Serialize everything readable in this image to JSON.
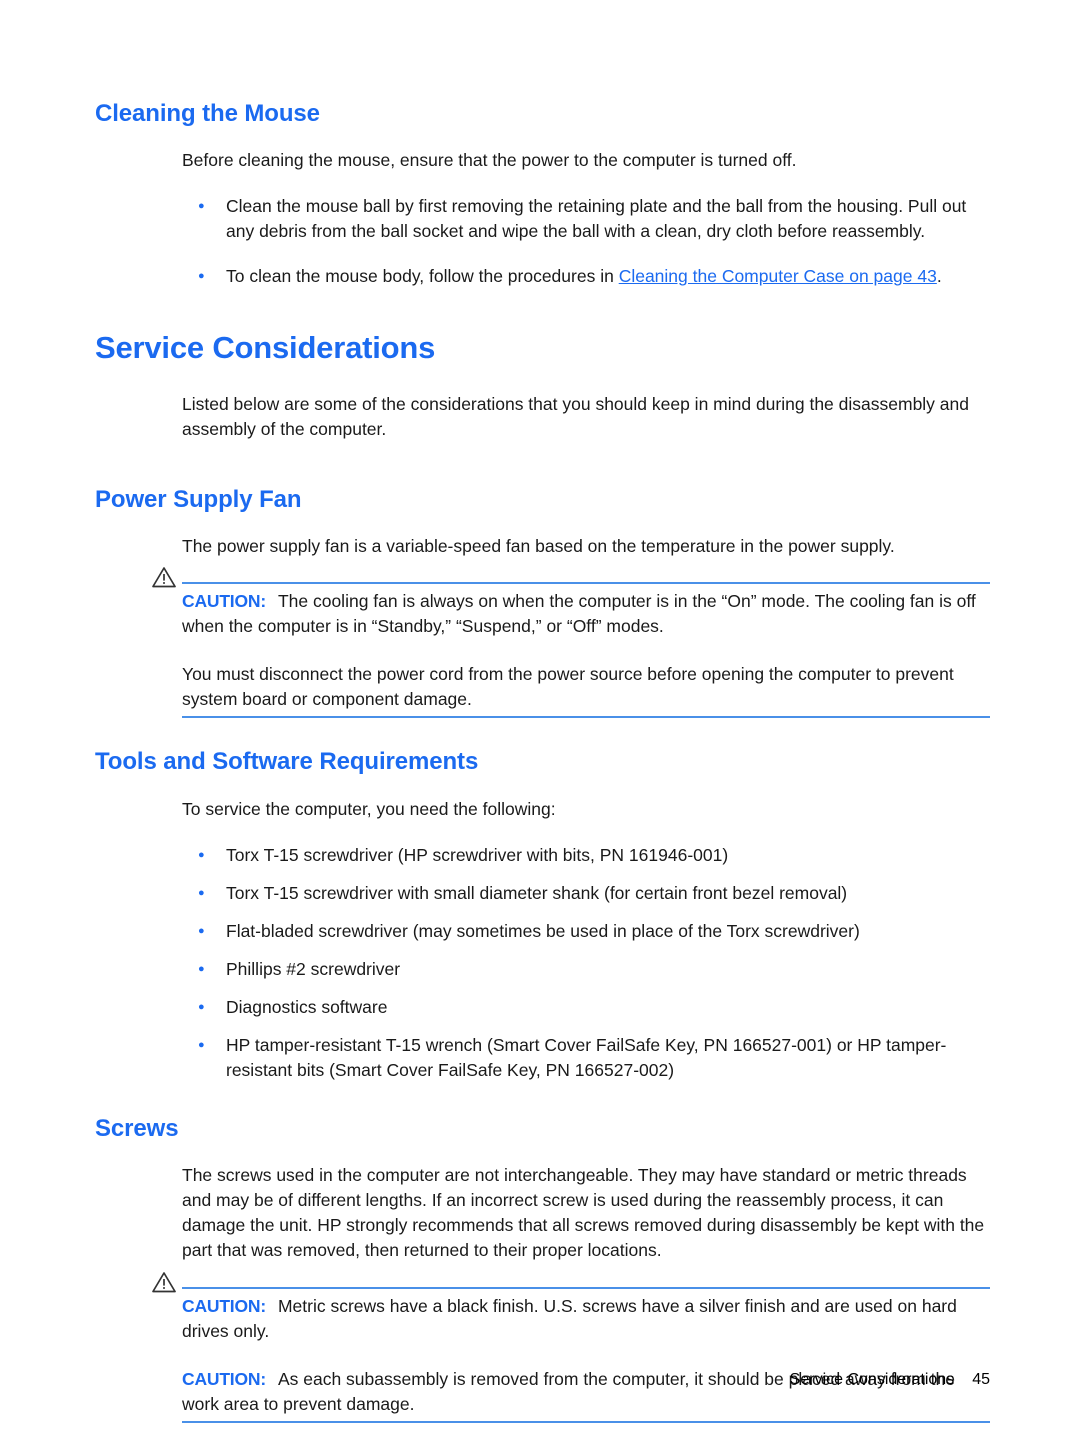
{
  "page": {
    "footer_title": "Service Considerations",
    "footer_page_number": "45"
  },
  "colors": {
    "heading_blue": "#1B6AF0",
    "rule_blue": "#4A90E8",
    "link_blue": "#1B6AF0",
    "body_black": "#1A1A1A"
  },
  "sections": {
    "cleaning_the_mouse": {
      "heading": "Cleaning the Mouse",
      "intro": "Before cleaning the mouse, ensure that the power to the computer is turned off.",
      "bullets": [
        {
          "text": "Clean the mouse ball by first removing the retaining plate and the ball from the housing. Pull out any debris from the ball socket and wipe the ball with a clean, dry cloth before reassembly."
        },
        {
          "text_before_link": "To clean the mouse body, follow the procedures in ",
          "link_text": "Cleaning the Computer Case on page 43",
          "text_after_link": "."
        }
      ]
    },
    "service_considerations": {
      "heading": "Service Considerations",
      "intro": "Listed below are some of the considerations that you should keep in mind during the disassembly and assembly of the computer."
    },
    "power_supply_fan": {
      "heading": "Power Supply Fan",
      "paragraph": "The power supply fan is a variable-speed fan based on the temperature in the power supply.",
      "caution": {
        "label": "CAUTION:",
        "icon": "warning-triangle-icon",
        "text": "The cooling fan is always on when the computer is in the “On” mode. The cooling fan is off when the computer is in “Standby,” “Suspend,” or “Off” modes."
      },
      "caution_followup": "You must disconnect the power cord from the power source before opening the computer to prevent system board or component damage."
    },
    "tools_and_software_requirements": {
      "heading": "Tools and Software Requirements",
      "intro": "To service the computer, you need the following:",
      "bullets": [
        "Torx T-15 screwdriver (HP screwdriver with bits, PN 161946-001)",
        "Torx T-15 screwdriver with small diameter shank (for certain front bezel removal)",
        "Flat-bladed screwdriver (may sometimes be used in place of the Torx screwdriver)",
        "Phillips #2 screwdriver",
        "Diagnostics software",
        "HP tamper-resistant T-15 wrench (Smart Cover FailSafe Key, PN 166527-001) or HP tamper-resistant bits (Smart Cover FailSafe Key, PN 166527-002)"
      ]
    },
    "screws": {
      "heading": "Screws",
      "paragraph": "The screws used in the computer are not interchangeable. They may have standard or metric threads and may be of different lengths. If an incorrect screw is used during the reassembly process, it can damage the unit. HP strongly recommends that all screws removed during disassembly be kept with the part that was removed, then returned to their proper locations.",
      "caution_1": {
        "label": "CAUTION:",
        "icon": "warning-triangle-icon",
        "text": "Metric screws have a black finish. U.S. screws have a silver finish and are used on hard drives only."
      },
      "caution_2": {
        "label": "CAUTION:",
        "text": "As each subassembly is removed from the computer, it should be placed away from the work area to prevent damage."
      }
    }
  }
}
